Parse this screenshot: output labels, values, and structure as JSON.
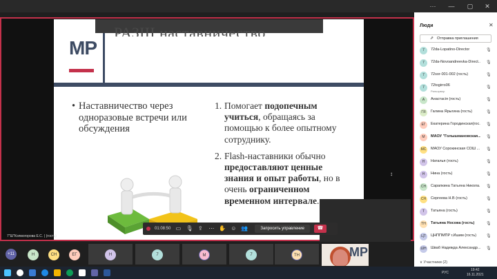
{
  "window": {
    "buttons": {
      "more": "···",
      "minimize": "—",
      "maximize": "▢",
      "close": "✕"
    }
  },
  "slide": {
    "logo": "MP",
    "title": "РАЗШ наставничество",
    "left_bullet": "Наставничество через одноразовые встречи или обсуждения",
    "right_items": [
      {
        "num": "1.",
        "pre": "Помогает ",
        "bold": "подопечным учиться",
        "post": ", обращаясь за помощью к более опытному сотруднику."
      },
      {
        "num": "2.",
        "pre": "Flash-наставники обычно ",
        "bold": "предоставляют ценные знания и опыт работы",
        "post": ", но в очень ",
        "bold2": "ограниченном временном интервале",
        "post2": "."
      }
    ]
  },
  "presenter": {
    "label": "7\"Ш\"Колмогорова Е.С. ( (гость)"
  },
  "controls": {
    "timer": "01:08:50",
    "request_label": "Запросить управление",
    "icons": [
      "camera-icon",
      "mic-off-icon",
      "share-icon",
      "more-icon",
      "hand-icon",
      "reactions-icon",
      "participants-icon"
    ]
  },
  "gallery": {
    "more_count": "+11",
    "tiles": [
      {
        "initials": "Н",
        "color": "#c8e6c9"
      },
      {
        "initials": "СН",
        "color": "#ffe082"
      },
      {
        "initials": "ЕГ",
        "color": "#ffccbc"
      },
      {
        "initials": "Н",
        "color": "#d1c4e9"
      },
      {
        "initials": "7",
        "color": "#b2dfdb"
      },
      {
        "initials": "М",
        "color": "#f8bbd0"
      },
      {
        "initials": "7",
        "color": "#b2dfdb"
      },
      {
        "initials": "ТН",
        "color": "#ffe0b2"
      }
    ],
    "video_logo": "MP"
  },
  "panel": {
    "title": "Люди",
    "invite_label": "Отправка приглашения",
    "participants": [
      {
        "initials": "7",
        "name": "72dа-Lopatino-Director",
        "color": "#b2dfdb"
      },
      {
        "initials": "7",
        "name": "72dа-Novoandreevka-Direct...",
        "color": "#b2dfdb"
      },
      {
        "initials": "7",
        "name": "72sоr-001-002 (гость)",
        "color": "#b2dfdb"
      },
      {
        "initials": "7",
        "name": "72togirro06",
        "sub": "Рильорвор",
        "color": "#b2dfdb"
      },
      {
        "initials": "А",
        "name": "Анастасія (гость)",
        "color": "#c8e6c9"
      },
      {
        "initials": "ГЯ",
        "name": "Галина Ярыгина (гость)",
        "color": "#dcedc8"
      },
      {
        "initials": "ЕГ",
        "name": "Екатерина Городинская(гос...",
        "color": "#ffccbc"
      },
      {
        "initials": "М",
        "name": "МАОУ \"Голышмановская...",
        "color": "#ffccbc",
        "bold": true
      },
      {
        "initials": "МС",
        "name": "МАОУ Сорокинская СОШ ...",
        "color": "#ffe082"
      },
      {
        "initials": "Н",
        "name": "Наталья (гость)",
        "color": "#d1c4e9"
      },
      {
        "initials": "Н",
        "name": "Нина (гость)",
        "color": "#d1c4e9"
      },
      {
        "initials": "СН",
        "name": "Сарапкина Татьяна Никола...",
        "color": "#c8e6c9"
      },
      {
        "initials": "СН",
        "name": "Сергеева Н.В (гость)",
        "color": "#ffe082"
      },
      {
        "initials": "Т",
        "name": "Татьяна (гость)",
        "color": "#d1c4e9"
      },
      {
        "initials": "ТН",
        "name": "Татьяна Носова (гость)",
        "color": "#ffe0b2",
        "bold": true
      },
      {
        "initials": "ЦТ",
        "name": "ЦНППМПР г.Ишим (гость)",
        "color": "#c5cae9"
      },
      {
        "initials": "ШН",
        "name": "Шваб Надежда Александр...",
        "color": "#c5cae9"
      }
    ],
    "section": "∨ Участники (2)"
  },
  "taskbar": {
    "lang": "РУС",
    "time": "19:42",
    "date": "16.11.2021"
  }
}
